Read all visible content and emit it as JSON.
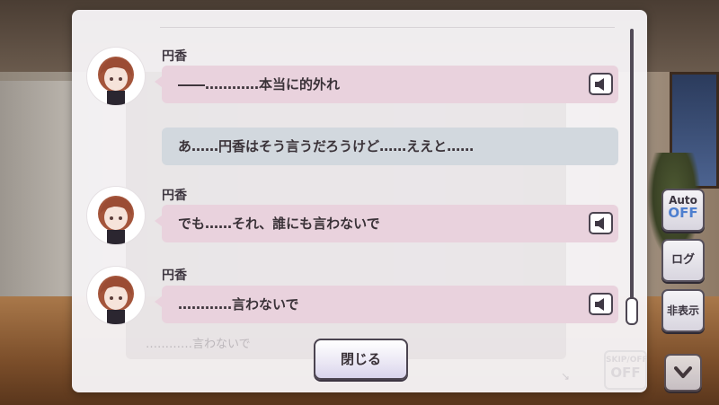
{
  "log": {
    "entries": [
      {
        "speaker": "円香",
        "text": "――…………本当に的外れ",
        "has_voice": true
      },
      {
        "speaker": "",
        "text": "あ……円香はそう言うだろうけど……ええと……",
        "has_voice": false
      },
      {
        "speaker": "円香",
        "text": "でも……それ、誰にも言わないで",
        "has_voice": true
      },
      {
        "speaker": "円香",
        "text": "…………言わないで",
        "has_voice": true
      }
    ],
    "close_label": "閉じる"
  },
  "background_ghost": {
    "text": "…………言わないで",
    "box_top": "SKIP/OFF",
    "box_main": "OFF"
  },
  "side_menu": {
    "auto_label": "Auto",
    "auto_state": "OFF",
    "log_label": "ログ",
    "hide_label": "非表示"
  },
  "icons": {
    "voice": "speaker-icon",
    "scroll_down": "chevron-down-icon",
    "avatar": "character-avatar"
  },
  "colors": {
    "speaker_bubble": "#e9d2dd",
    "narration_bubble": "#d2d8de",
    "auto_off": "#4e7fcf"
  }
}
